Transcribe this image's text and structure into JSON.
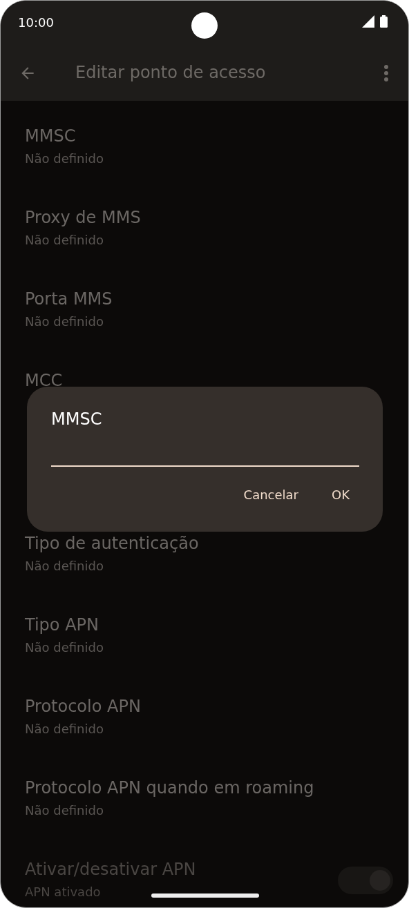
{
  "status_bar": {
    "time": "10:00"
  },
  "app_bar": {
    "title": "Editar ponto de acesso"
  },
  "settings": [
    {
      "kind": "item",
      "title": "MMSC",
      "summary": "Não definido",
      "disabled": false
    },
    {
      "kind": "item",
      "title": "Proxy de MMS",
      "summary": "Não definido",
      "disabled": false
    },
    {
      "kind": "item",
      "title": "Porta MMS",
      "summary": "Não definido",
      "disabled": false
    },
    {
      "kind": "item",
      "title": "MCC",
      "disabled": false
    },
    {
      "kind": "covered"
    },
    {
      "kind": "item",
      "title": "Tipo de autenticação",
      "summary": "Não definido",
      "disabled": false
    },
    {
      "kind": "item",
      "title": "Tipo APN",
      "summary": "Não definido",
      "disabled": false
    },
    {
      "kind": "item",
      "title": "Protocolo APN",
      "summary": "Não definido",
      "disabled": false
    },
    {
      "kind": "item",
      "title": "Protocolo APN quando em roaming",
      "summary": "Não definido",
      "disabled": false
    },
    {
      "kind": "switch",
      "title": "Ativar/desativar APN",
      "summary": "APN ativado",
      "disabled": true,
      "on": true
    }
  ],
  "dialog": {
    "title": "MMSC",
    "buttons": [
      "Cancelar",
      "OK"
    ]
  }
}
